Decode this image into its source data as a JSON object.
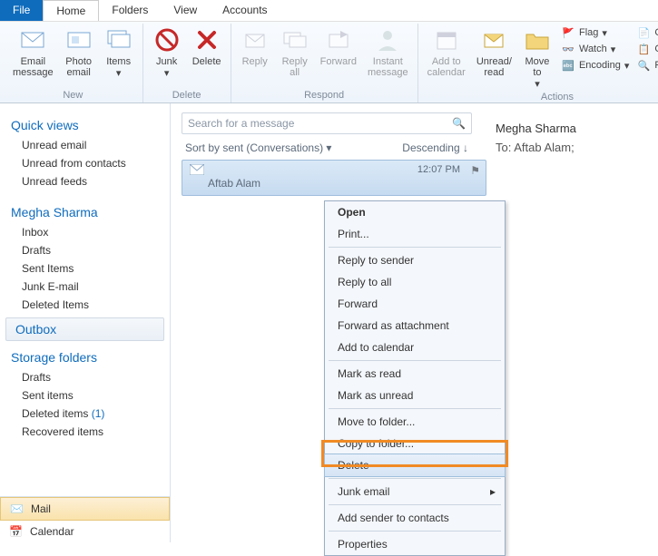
{
  "menubar": {
    "file": "File",
    "home": "Home",
    "folders": "Folders",
    "view": "View",
    "accounts": "Accounts"
  },
  "ribbon": {
    "new": {
      "email": "Email\nmessage",
      "photo": "Photo\nemail",
      "items": "Items",
      "label": "New"
    },
    "delete": {
      "junk": "Junk",
      "delete": "Delete",
      "label": "Delete"
    },
    "respond": {
      "reply": "Reply",
      "replyall": "Reply\nall",
      "forward": "Forward",
      "instant": "Instant\nmessage",
      "label": "Respond"
    },
    "actions": {
      "addcal": "Add to\ncalendar",
      "unread": "Unread/\nread",
      "moveto": "Move\nto",
      "flag": "Flag",
      "watch": "Watch",
      "encoding": "Encoding",
      "copyto": "Copy to",
      "copy": "Copy",
      "find": "Find",
      "label": "Actions"
    }
  },
  "sidebar": {
    "quickviews": {
      "title": "Quick views",
      "items": [
        "Unread email",
        "Unread from contacts",
        "Unread feeds"
      ]
    },
    "account": {
      "title": "Megha Sharma",
      "items": [
        "Inbox",
        "Drafts",
        "Sent Items",
        "Junk E-mail",
        "Deleted Items"
      ]
    },
    "outbox": "Outbox",
    "storage": {
      "title": "Storage folders",
      "items": [
        "Drafts",
        "Sent items"
      ],
      "deleted": "Deleted items",
      "deleted_count": "(1)",
      "recovered": "Recovered items"
    },
    "bottom": {
      "mail": "Mail",
      "calendar": "Calendar"
    }
  },
  "msglist": {
    "search_placeholder": "Search for a message",
    "sort": "Sort by sent (Conversations)",
    "order": "Descending",
    "msg": {
      "sender": "Aftab Alam",
      "time": "12:07 PM"
    }
  },
  "reading": {
    "from": "Megha Sharma",
    "to_label": "To:",
    "to": "Aftab Alam;"
  },
  "ctx": {
    "open": "Open",
    "print": "Print...",
    "reply_sender": "Reply to sender",
    "reply_all": "Reply to all",
    "forward": "Forward",
    "fwd_attach": "Forward as attachment",
    "add_cal": "Add to calendar",
    "mark_read": "Mark as read",
    "mark_unread": "Mark as unread",
    "move_folder": "Move to folder...",
    "copy_folder": "Copy to folder...",
    "delete": "Delete",
    "junk": "Junk email",
    "add_contact": "Add sender to contacts",
    "properties": "Properties"
  }
}
